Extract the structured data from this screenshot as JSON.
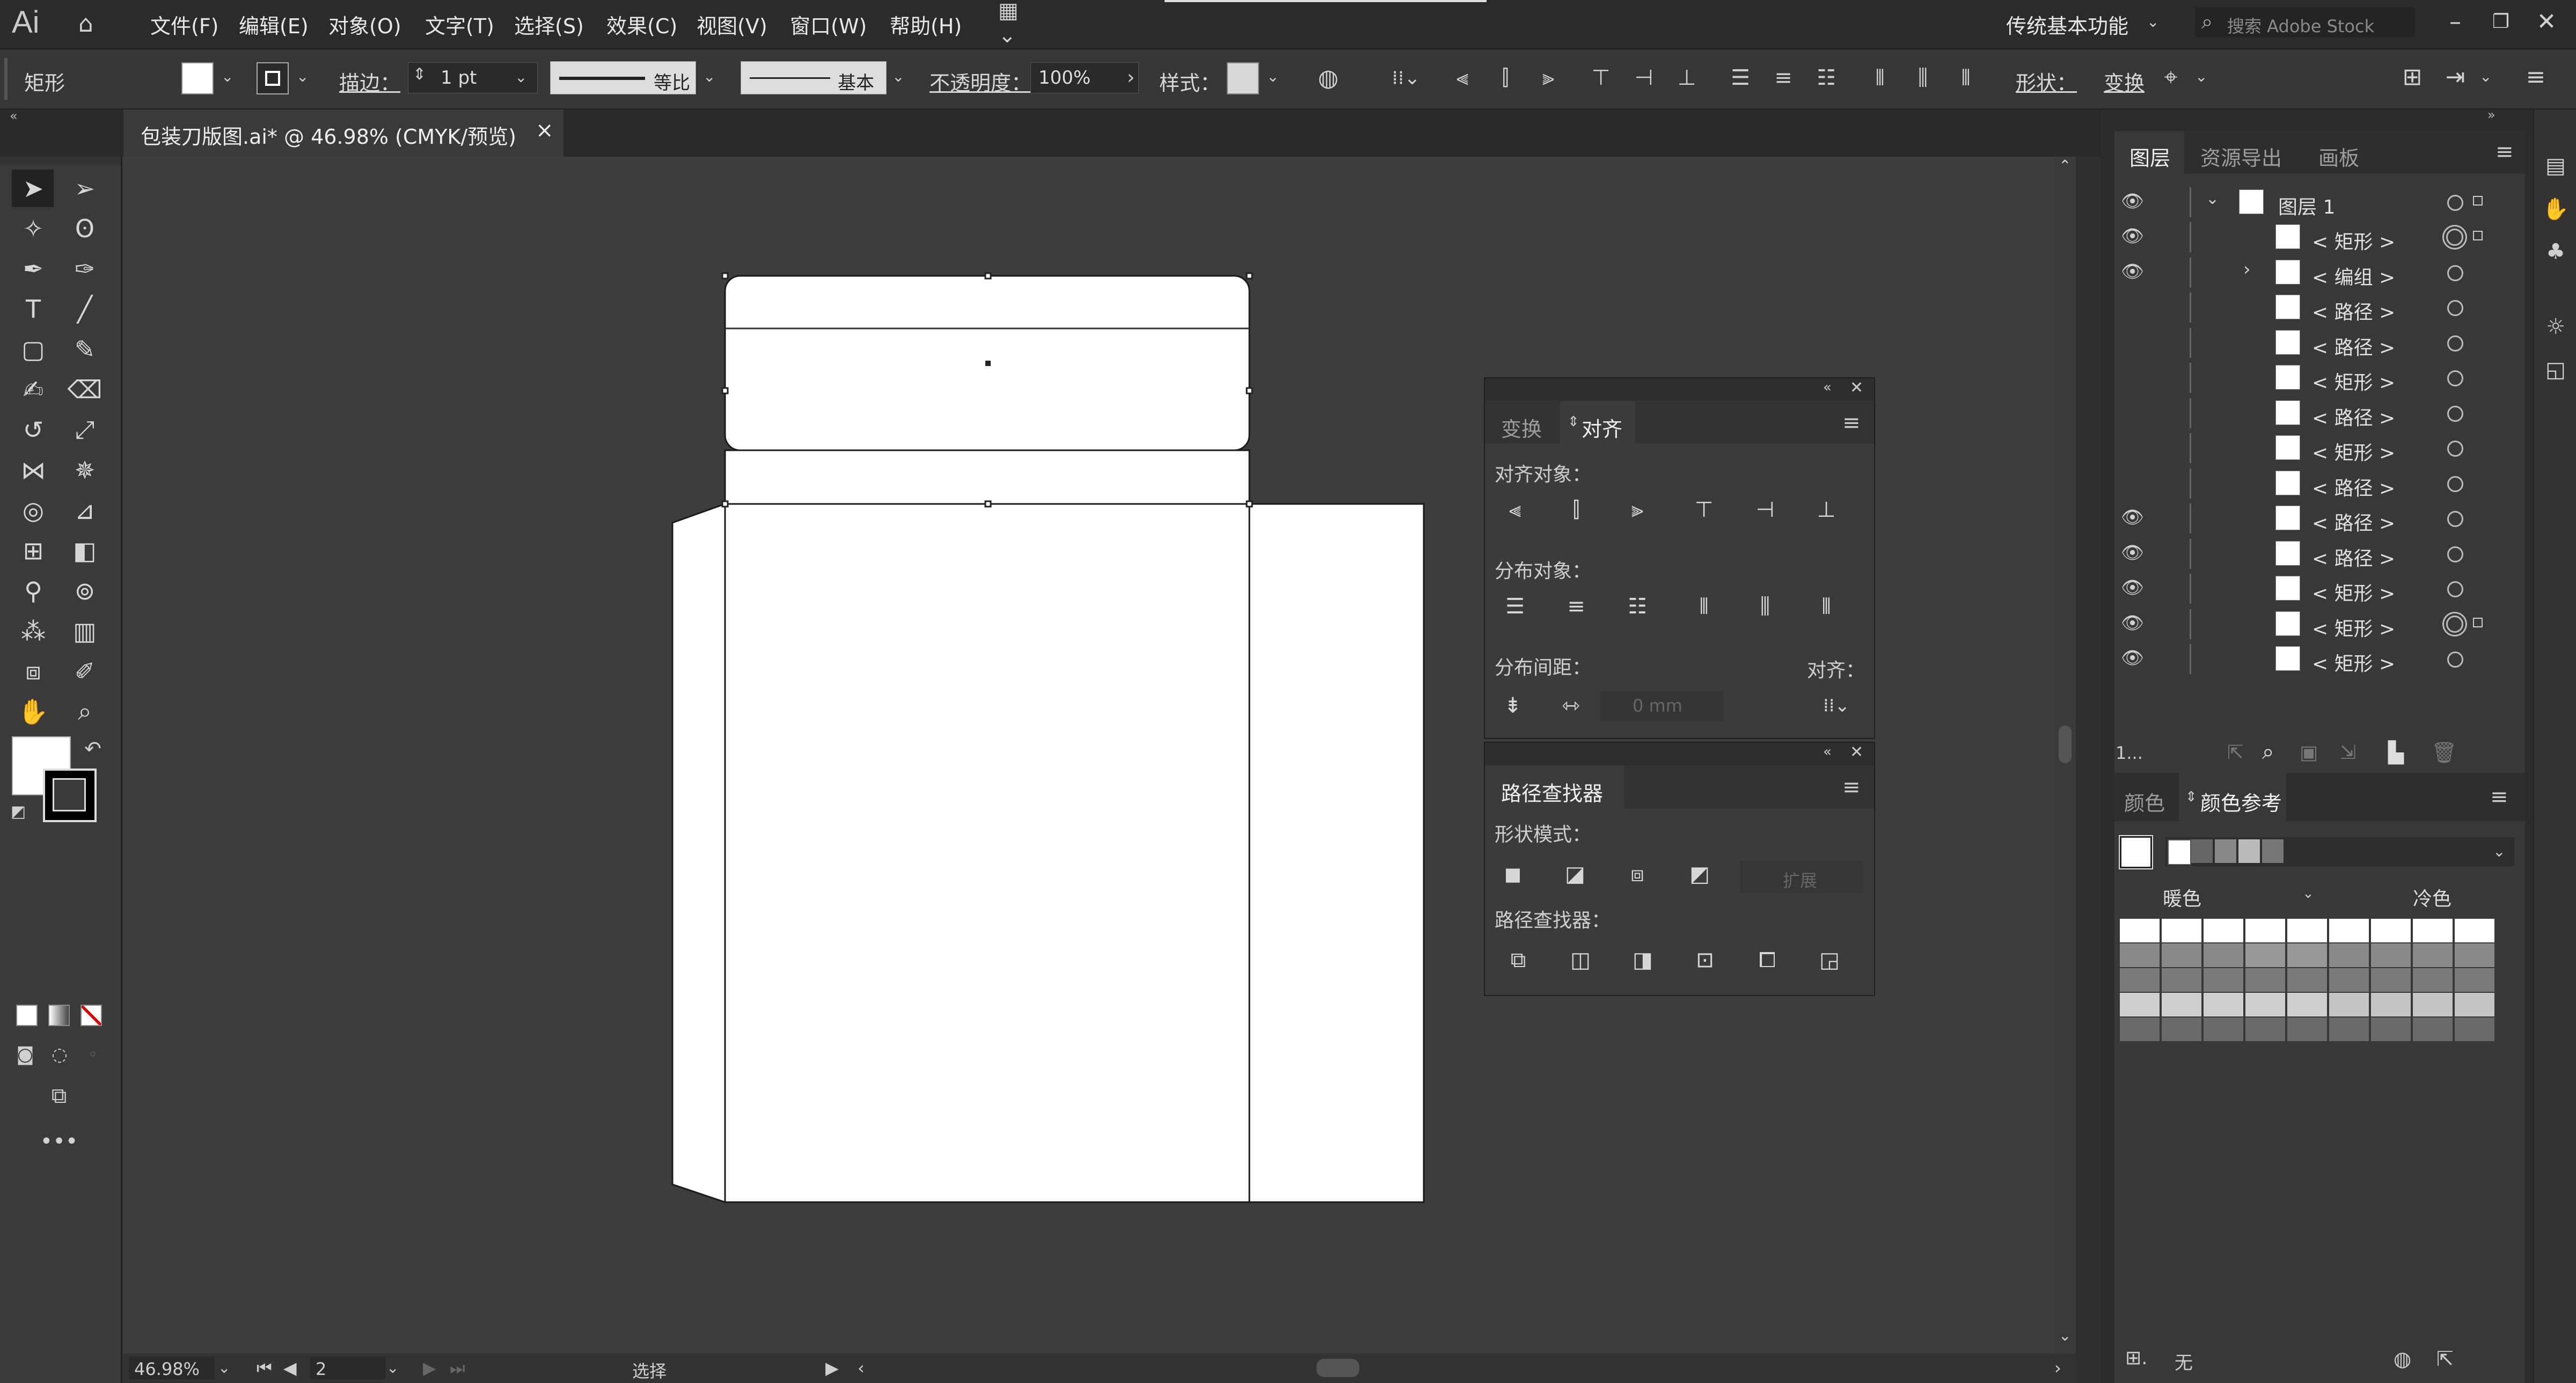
{
  "app": {
    "logo": "Ai",
    "menus": [
      "文件(F)",
      "编辑(E)",
      "对象(O)",
      "文字(T)",
      "选择(S)",
      "效果(C)",
      "视图(V)",
      "窗口(W)",
      "帮助(H)"
    ],
    "workspace": "传统基本功能",
    "search_placeholder": "搜索 Adobe Stock"
  },
  "control_bar": {
    "object_type": "矩形",
    "stroke_label": "描边：",
    "stroke_value": "1 pt",
    "profile_label": "等比",
    "brush_label": "基本",
    "opacity_label": "不透明度：",
    "opacity_value": "100%",
    "style_label": "样式：",
    "shape_label": "形状：",
    "transform_label": "变换"
  },
  "document": {
    "tab_title": "包装刀版图.ai* @ 46.98% (CMYK/预览)",
    "close": "×"
  },
  "status": {
    "zoom": "46.98%",
    "artboard": "2",
    "tool": "选择"
  },
  "align_panel": {
    "tab_transform": "变换",
    "tab_align": "对齐",
    "align_objects": "对齐对象：",
    "distribute_objects": "分布对象：",
    "distribute_spacing": "分布间距：",
    "align_to": "对齐：",
    "spacing_value": "0 mm"
  },
  "pathfinder_panel": {
    "title": "路径查找器",
    "shape_modes": "形状模式：",
    "expand": "扩展",
    "pathfinders": "路径查找器："
  },
  "layers_panel": {
    "tabs": [
      "图层",
      "资源导出",
      "画板"
    ],
    "layer_name": "图层 1",
    "items": [
      {
        "name": "< 矩形 >",
        "visible": true,
        "target": true
      },
      {
        "name": "< 编组 >",
        "visible": true,
        "target": false,
        "expandable": true
      },
      {
        "name": "< 路径 >",
        "visible": false,
        "target": false
      },
      {
        "name": "< 路径 >",
        "visible": false,
        "target": false
      },
      {
        "name": "< 矩形 >",
        "visible": false,
        "target": false
      },
      {
        "name": "< 路径 >",
        "visible": false,
        "target": false
      },
      {
        "name": "< 矩形 >",
        "visible": false,
        "target": false
      },
      {
        "name": "< 路径 >",
        "visible": false,
        "target": false
      },
      {
        "name": "< 路径 >",
        "visible": true,
        "target": false
      },
      {
        "name": "< 路径 >",
        "visible": true,
        "target": false
      },
      {
        "name": "< 矩形 >",
        "visible": true,
        "target": false
      },
      {
        "name": "< 矩形 >",
        "visible": true,
        "target": true
      },
      {
        "name": "< 矩形 >",
        "visible": true,
        "target": false
      }
    ],
    "footer_count": "1..."
  },
  "color_panel": {
    "tab_color": "颜色",
    "tab_guide": "颜色参考",
    "warm": "暖色",
    "cool": "冷色",
    "footer_none": "无"
  }
}
